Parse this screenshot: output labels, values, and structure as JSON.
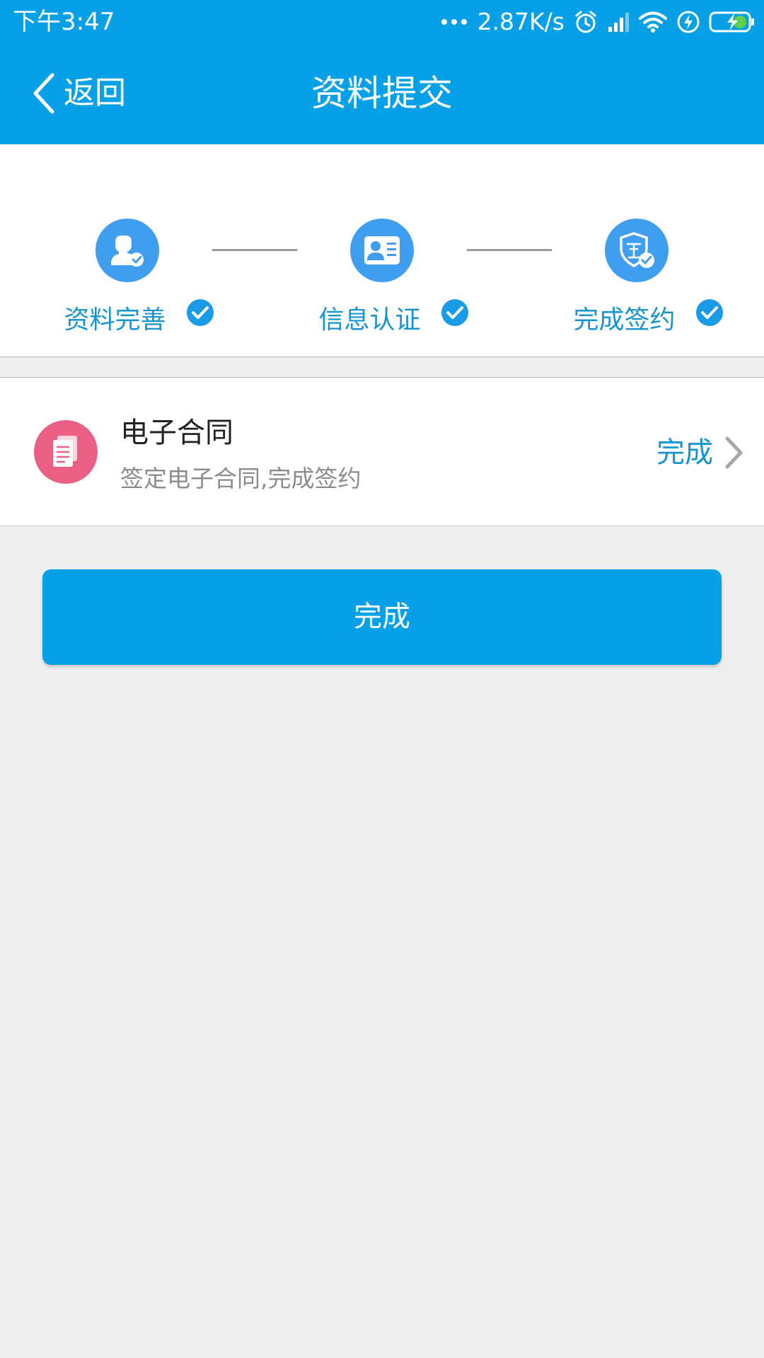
{
  "status_bar": {
    "time": "下午3:47",
    "net_speed": "2.87K/s",
    "icons": [
      "more-dots-icon",
      "alarm-icon",
      "signal-icon",
      "wifi-icon",
      "flash-icon",
      "battery-charging-icon"
    ]
  },
  "title_bar": {
    "back_label": "返回",
    "title": "资料提交"
  },
  "steps": [
    {
      "label": "资料完善",
      "icon": "user-check-icon",
      "completed": true
    },
    {
      "label": "信息认证",
      "icon": "id-card-icon",
      "completed": true
    },
    {
      "label": "完成签约",
      "icon": "certified-shield-icon",
      "completed": true
    }
  ],
  "contract_item": {
    "icon": "document-icon",
    "title": "电子合同",
    "description": "签定电子合同,完成签约",
    "status": "完成"
  },
  "finish_button": {
    "label": "完成"
  },
  "colors": {
    "primary": "#06a0e8",
    "step_circle": "#3f9ef0",
    "accent_text": "#1694d2",
    "contract_icon_bg": "#ea5f84",
    "background": "#efefef"
  }
}
